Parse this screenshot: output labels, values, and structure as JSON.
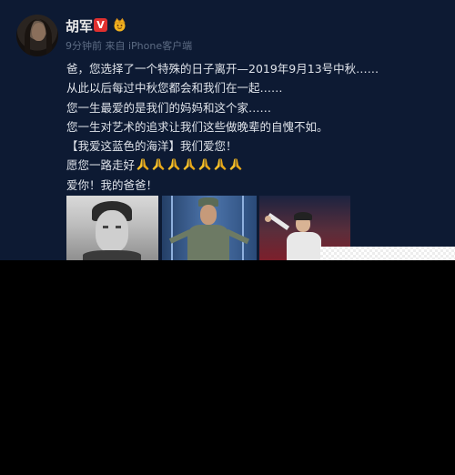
{
  "post": {
    "username": "胡军",
    "verified_badge": "V",
    "meta": "9分钟前 来自 iPhone客户端",
    "lines": [
      "爸，您选择了一个特殊的日子离开—2019年9月13号中秋……",
      "从此以后每过中秋您都会和我们在一起……",
      "您一生最爱的是我们的妈妈和这个家……",
      "您一生对艺术的追求让我们这些做晚辈的自愧不如。",
      "【我爱这蓝色的海洋】我们爱您！",
      "愿您一路走好",
      "爱你！我的爸爸！"
    ],
    "pray_emoji_count": 7,
    "photos": [
      "portrait-photo",
      "stage-photo-uniform",
      "stage-photo-singing"
    ]
  },
  "colors": {
    "background": "#0d1a33",
    "text": "#dfe3ea",
    "meta": "#5d6c84",
    "badge": "#e0302f"
  }
}
